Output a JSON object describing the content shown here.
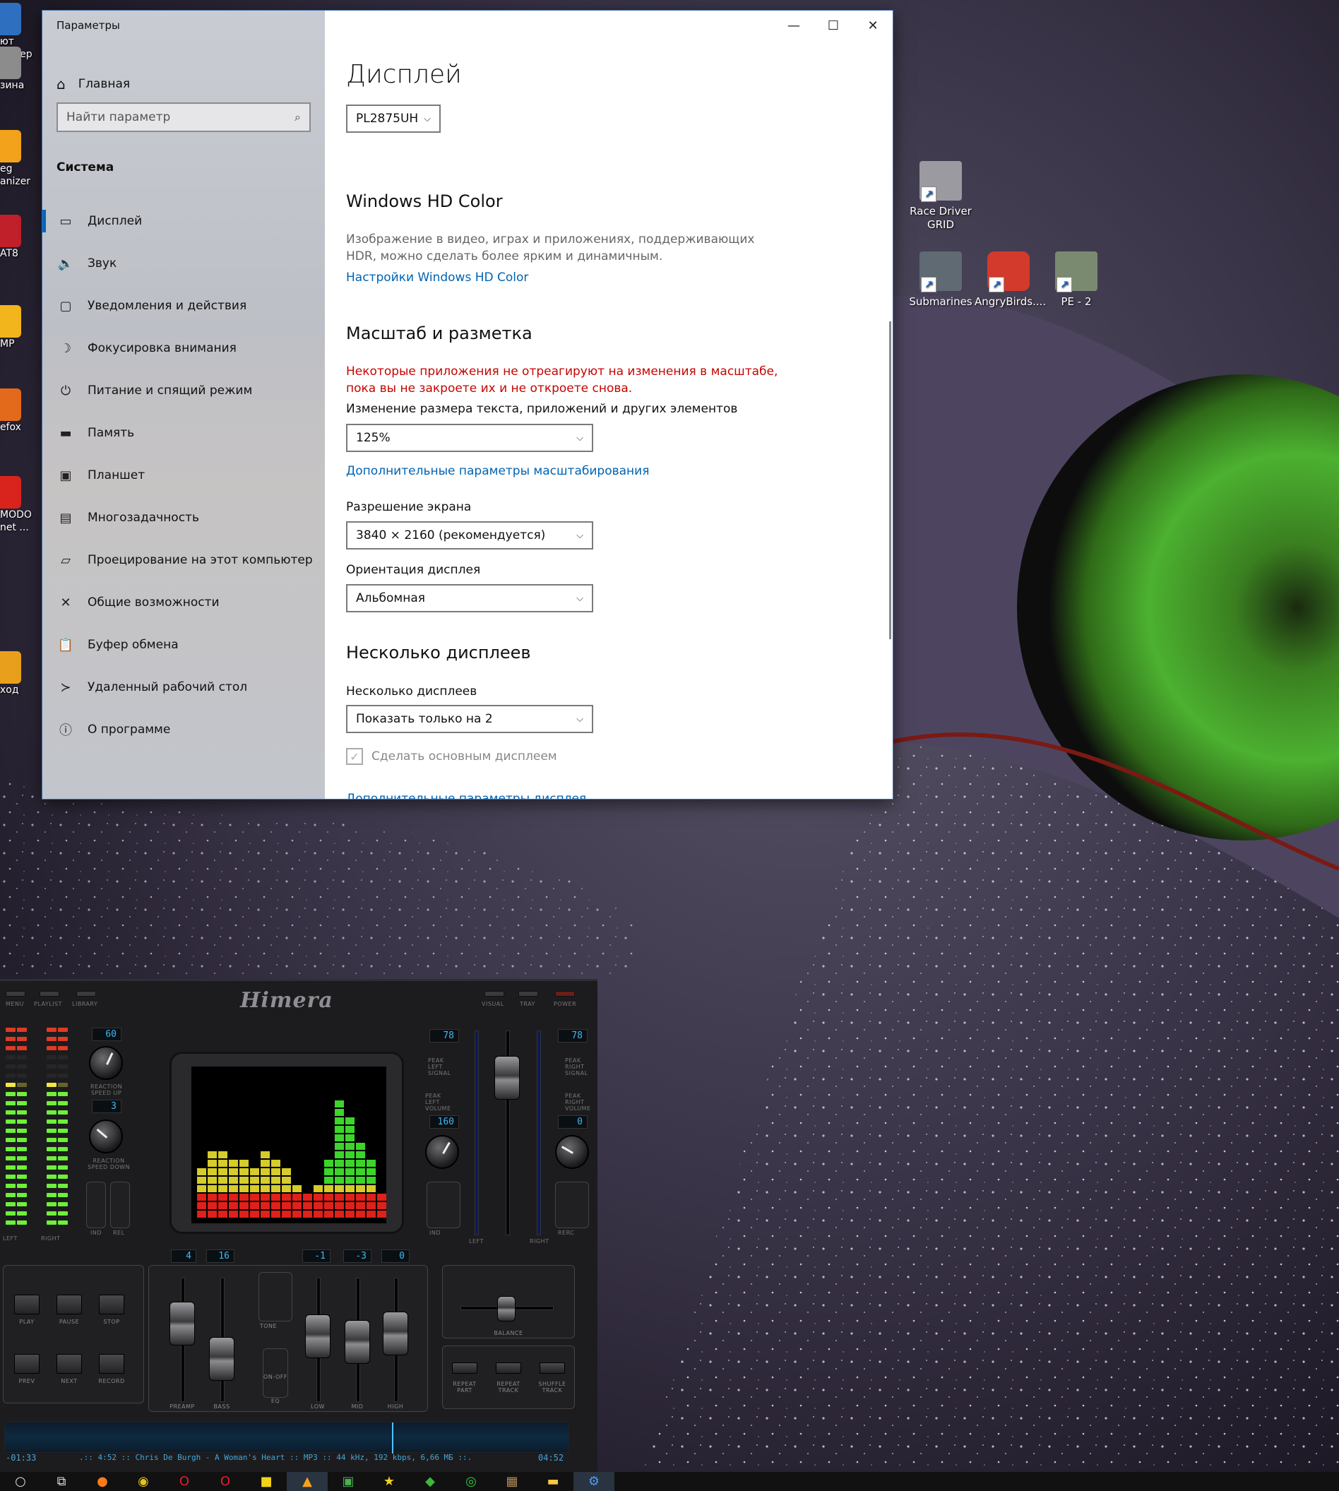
{
  "settings": {
    "window_title": "Параметры",
    "home_label": "Главная",
    "search_placeholder": "Найти параметр",
    "section": "Система",
    "nav": [
      {
        "label": "Дисплей",
        "icon": "monitor-icon",
        "glyph": "▭"
      },
      {
        "label": "Звук",
        "icon": "speaker-icon",
        "glyph": "🔈"
      },
      {
        "label": "Уведомления и действия",
        "icon": "notification-icon",
        "glyph": "▢"
      },
      {
        "label": "Фокусировка внимания",
        "icon": "moon-icon",
        "glyph": "☽"
      },
      {
        "label": "Питание и спящий режим",
        "icon": "power-icon",
        "glyph": "⏻"
      },
      {
        "label": "Память",
        "icon": "storage-icon",
        "glyph": "▬"
      },
      {
        "label": "Планшет",
        "icon": "tablet-icon",
        "glyph": "▣"
      },
      {
        "label": "Многозадачность",
        "icon": "multitask-icon",
        "glyph": "▤"
      },
      {
        "label": "Проецирование на этот компьютер",
        "icon": "project-icon",
        "glyph": "▱"
      },
      {
        "label": "Общие возможности",
        "icon": "shared-icon",
        "glyph": "✕"
      },
      {
        "label": "Буфер обмена",
        "icon": "clipboard-icon",
        "glyph": "📋"
      },
      {
        "label": "Удаленный рабочий стол",
        "icon": "remote-icon",
        "glyph": "≻"
      },
      {
        "label": "О программе",
        "icon": "info-icon",
        "glyph": "ⓘ"
      }
    ],
    "page_title": "Дисплей",
    "monitor_select": "PL2875UH",
    "hdr": {
      "heading": "Windows HD Color",
      "desc_line1": "Изображение в видео, играх и приложениях, поддерживающих",
      "desc_line2": "HDR, можно сделать более ярким и динамичным.",
      "link": "Настройки Windows HD Color"
    },
    "scale": {
      "heading": "Масштаб и разметка",
      "warning_line1": "Некоторые приложения не отреагируют на изменения в масштабе,",
      "warning_line2": "пока вы не закроете их и не откроете снова.",
      "size_label": "Изменение размера текста, приложений и других элементов",
      "size_value": "125%",
      "advanced_link": "Дополнительные параметры масштабирования",
      "resolution_label": "Разрешение экрана",
      "resolution_value": "3840 × 2160 (рекомендуется)",
      "orientation_label": "Ориентация дисплея",
      "orientation_value": "Альбомная"
    },
    "multi": {
      "heading": "Несколько дисплеев",
      "label": "Несколько дисплеев",
      "value": "Показать только на 2",
      "checkbox": "Сделать основным дисплеем",
      "advanced_link": "Дополнительные параметры дисплея"
    }
  },
  "desktop": {
    "left_icons": [
      "ют\nьютер",
      "зина",
      "eg\nanizer",
      "AT8",
      "MP",
      "efox",
      "MODO\nnet ...",
      "ход"
    ],
    "right_icons": [
      {
        "label": "Race Driver\nGRID",
        "color": "#9a9aa0"
      },
      {
        "label": "Submarines",
        "color": "#5f6a72"
      },
      {
        "label": "AngryBirds....",
        "color": "#d33a2c"
      },
      {
        "label": "PE - 2",
        "color": "#7a8a70"
      }
    ]
  },
  "player": {
    "logo": "Himera",
    "top_left": [
      "MENU",
      "PLAYLIST",
      "LIBRARY"
    ],
    "top_right": [
      "VISUAL",
      "TRAY",
      "POWER"
    ],
    "lcd": {
      "reaction_up": "60",
      "reaction_down": "3",
      "left_peak": "78",
      "right_peak": "78",
      "left_vol": "160",
      "right_vol": "0",
      "preamp": "4",
      "bass": "16",
      "low": "-1",
      "mid": "-3",
      "high": "0"
    },
    "labels": {
      "reaction_up": "REACTION\nSPEED UP",
      "reaction_down": "REACTION\nSPEED DOWN",
      "peak_left": "PEAK\nLEFT\nSIGNAL",
      "peak_left_vol": "PEAK\nLEFT\nVOLUME",
      "peak_right": "PEAK\nRIGHT\nSIGNAL",
      "peak_right_vol": "PEAK\nRIGHT\nVOLUME",
      "left": "LEFT",
      "right": "RIGHT",
      "ind": "IND",
      "rel": "REL",
      "on": "ON",
      "off": "OFF",
      "rerc": "RERC",
      "play": "PLAY",
      "pause": "PAUSE",
      "stop": "STOP",
      "prev": "PREV",
      "next": "NEXT",
      "record": "RECORD",
      "preamp": "PREAMP",
      "bass": "BASS",
      "tone": "TONE",
      "onoff": "ON-OFF",
      "eq": "EQ",
      "low": "LOW",
      "mid": "MID",
      "high": "HIGH",
      "balance": "BALANCE",
      "repeat_part": "REPEAT\nPART",
      "repeat_track": "REPEAT\nTRACK",
      "shuffle_track": "SHUFFLE\nTRACK"
    },
    "time_elapsed": "-01:33",
    "track_info": ".:: 4:52 :: Chris De Burgh - A Woman's Heart :: MP3 :: 44 kHz, 192 kbps, 6,66 МБ ::.",
    "time_total": "04:52",
    "spectrum": [
      6,
      8,
      8,
      7,
      7,
      6,
      8,
      7,
      6,
      4,
      3,
      4,
      7,
      14,
      12,
      9,
      7,
      3
    ]
  },
  "taskbar": {
    "icons": [
      {
        "name": "search-icon",
        "glyph": "○"
      },
      {
        "name": "task-view-icon",
        "glyph": "⧉"
      },
      {
        "name": "firefox-icon",
        "glyph": "●"
      },
      {
        "name": "chrome-icon",
        "glyph": "◉"
      },
      {
        "name": "opera-icon",
        "glyph": "O"
      },
      {
        "name": "opera-gx-icon",
        "glyph": "O"
      },
      {
        "name": "sticky-icon",
        "glyph": "■"
      },
      {
        "name": "aimp-icon",
        "glyph": "▲"
      },
      {
        "name": "app-green-icon",
        "glyph": "▣"
      },
      {
        "name": "star-icon",
        "glyph": "★"
      },
      {
        "name": "gem-icon",
        "glyph": "◆"
      },
      {
        "name": "whatsapp-icon",
        "glyph": "◎"
      },
      {
        "name": "game-icon",
        "glyph": "▦"
      },
      {
        "name": "explorer-icon",
        "glyph": "▬"
      },
      {
        "name": "settings-gear-icon",
        "glyph": "⚙"
      }
    ]
  }
}
